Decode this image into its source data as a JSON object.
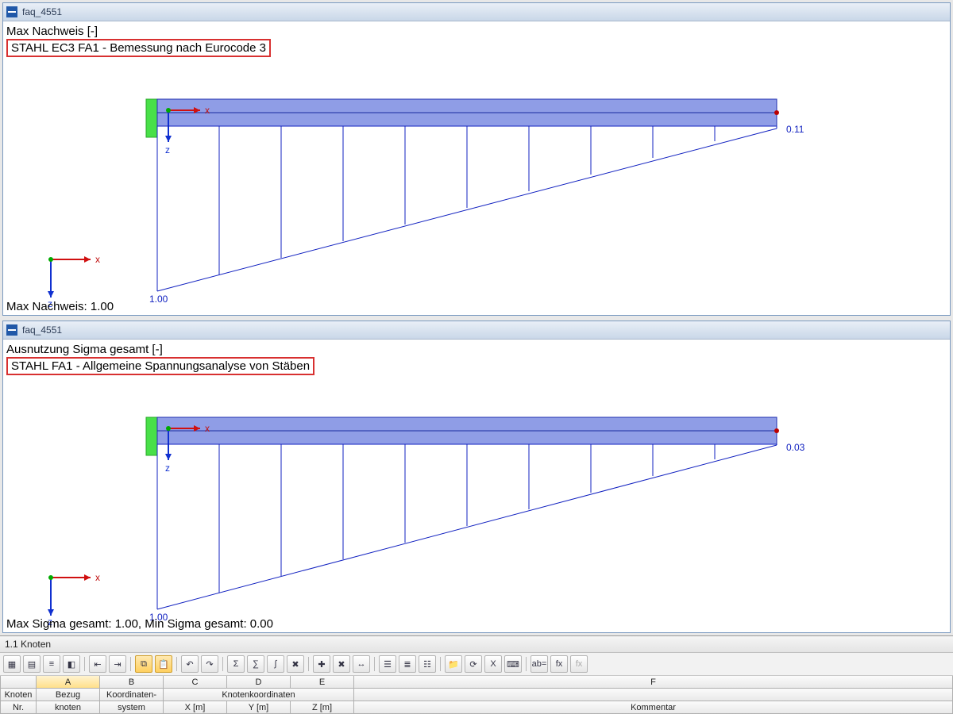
{
  "panels": [
    {
      "title": "faq_4551",
      "header1": "Max Nachweis [-]",
      "header2": "STAHL EC3 FA1 - Bemessung nach Eurocode 3",
      "right_value": "0.11",
      "left_value": "1.00",
      "footer": "Max Nachweis: 1.00"
    },
    {
      "title": "faq_4551",
      "header1": "Ausnutzung Sigma gesamt [-]",
      "header2": "STAHL FA1 - Allgemeine Spannungsanalyse von Stäben",
      "right_value": "0.03",
      "left_value": "1.00",
      "footer": "Max Sigma gesamt: 1.00, Min Sigma gesamt: 0.00"
    }
  ],
  "axis": {
    "x_label": "x",
    "z_label": "z"
  },
  "bottom": {
    "title": "1.1 Knoten",
    "col_letters": [
      "A",
      "B",
      "C",
      "D",
      "E",
      "F"
    ],
    "group_row": {
      "knoten_nr": "Knoten",
      "bezug": "Bezug",
      "koord": "Koordinaten-",
      "koordgrp": "Knotenkoordinaten",
      "kommentar": ""
    },
    "sub_row": {
      "nr": "Nr.",
      "bezug": "knoten",
      "system": "system",
      "x": "X [m]",
      "y": "Y [m]",
      "z": "Z [m]",
      "komm": "Kommentar"
    }
  },
  "toolbar_icons": [
    "grid-icon",
    "table-icon",
    "align-icon",
    "palette-icon",
    "sep",
    "import-icon",
    "export-icon",
    "sep",
    "copy-icon",
    "paste-icon",
    "sep",
    "undo-icon",
    "redo-icon",
    "sep",
    "calc-icon",
    "calc2-icon",
    "calc3-icon",
    "delete-icon",
    "sep",
    "node-add-icon",
    "node-del-icon",
    "node-split-icon",
    "sep",
    "list-icon",
    "list2-icon",
    "list3-icon",
    "sep",
    "folder-icon",
    "refresh-icon",
    "excel-icon",
    "calculator-icon",
    "sep",
    "text-icon",
    "fx-icon",
    "fx-off-icon"
  ],
  "chart_data": [
    {
      "type": "bar",
      "title": "Max Nachweis [-]",
      "x": [
        0,
        1,
        2,
        3,
        4,
        5,
        6,
        7,
        8,
        9,
        10
      ],
      "values": [
        1.0,
        0.9,
        0.8,
        0.7,
        0.6,
        0.5,
        0.4,
        0.3,
        0.2,
        0.15,
        0.11
      ],
      "ylim": [
        0,
        1.0
      ],
      "xlabel": "x",
      "ylabel": "z"
    },
    {
      "type": "bar",
      "title": "Ausnutzung Sigma gesamt [-]",
      "x": [
        0,
        1,
        2,
        3,
        4,
        5,
        6,
        7,
        8,
        9,
        10
      ],
      "values": [
        1.0,
        0.9,
        0.8,
        0.7,
        0.6,
        0.5,
        0.4,
        0.3,
        0.2,
        0.1,
        0.03
      ],
      "ylim": [
        0,
        1.0
      ],
      "xlabel": "x",
      "ylabel": "z"
    }
  ]
}
